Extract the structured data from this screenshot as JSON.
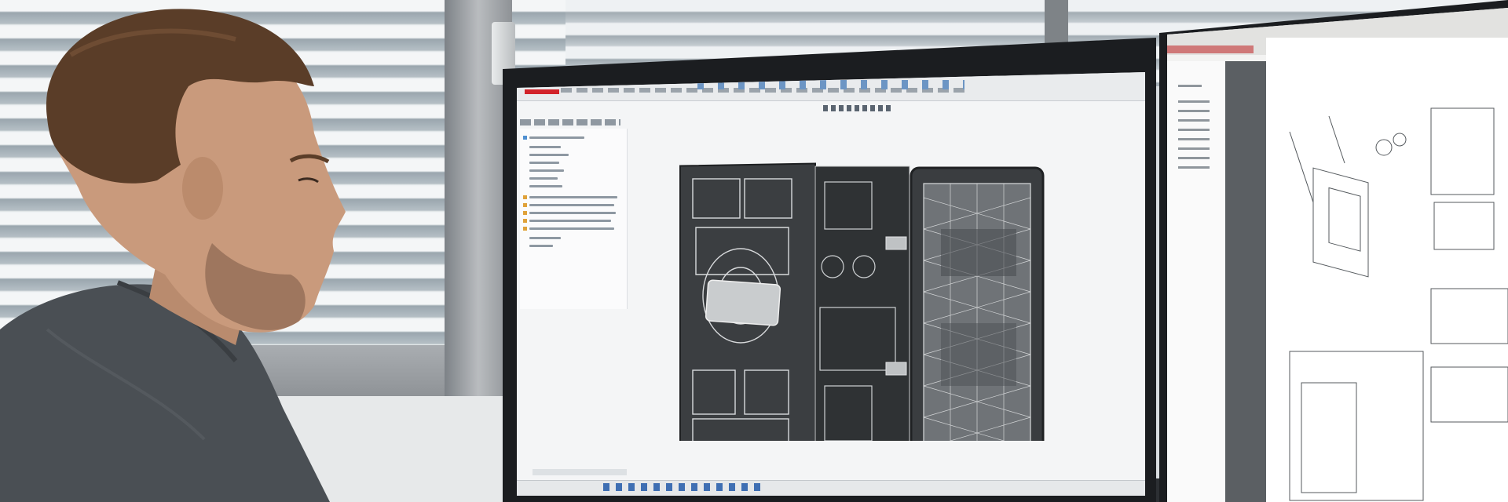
{
  "scene": {
    "description_labels": [],
    "colors": {
      "wall": "#e7e9ea",
      "blinds": "#f4f6f7",
      "monitor_bezel": "#1b1d20",
      "screen": "#f4f5f6",
      "model_dark": "#3a3d40",
      "shirt": "#4a4f54",
      "hair": "#5a3d28",
      "skin": "#c99a7c",
      "accent_red": "#d2232a"
    }
  },
  "cad_app": {
    "icons": [
      "solidworks-logo",
      "ribbon-icons",
      "feature-tree",
      "view-toolbar"
    ]
  },
  "taskbar": {
    "icons": [
      "start-icon",
      "search-icon",
      "file-explorer-icon",
      "browser-icon",
      "mail-icon",
      "solidworks-icon"
    ]
  },
  "pdf_viewer": {
    "icons": [
      "bookmark-icon",
      "page-thumbnails-icon"
    ]
  }
}
